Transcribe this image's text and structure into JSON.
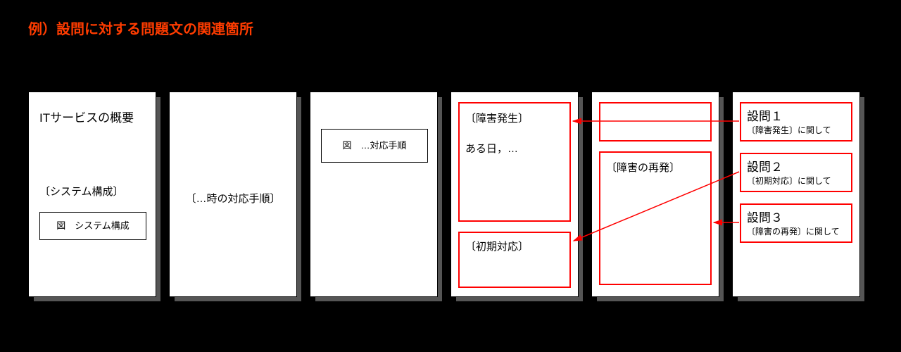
{
  "title": "例）設問に対する問題文の関連箇所",
  "page1": {
    "service_overview": "ITサービスの概要",
    "system_heading": "〔システム構成〕",
    "system_fig_caption": "図　システム構成"
  },
  "page2": {
    "heading": "〔…時の対応手順〕"
  },
  "page3": {
    "fig_caption": "図　…対応手順"
  },
  "page4": {
    "section1_heading": "〔障害発生〕",
    "section1_body": "ある日，…",
    "section2_heading": "〔初期対応〕"
  },
  "page5": {
    "section_heading": "〔障害の再発〕"
  },
  "page6": {
    "q1_title": "設問１",
    "q1_sub": "〔障害発生〕に関して",
    "q2_title": "設問２",
    "q2_sub": "〔初期対応〕に関して",
    "q3_title": "設問３",
    "q3_sub": "〔障害の再発〕に関して"
  }
}
